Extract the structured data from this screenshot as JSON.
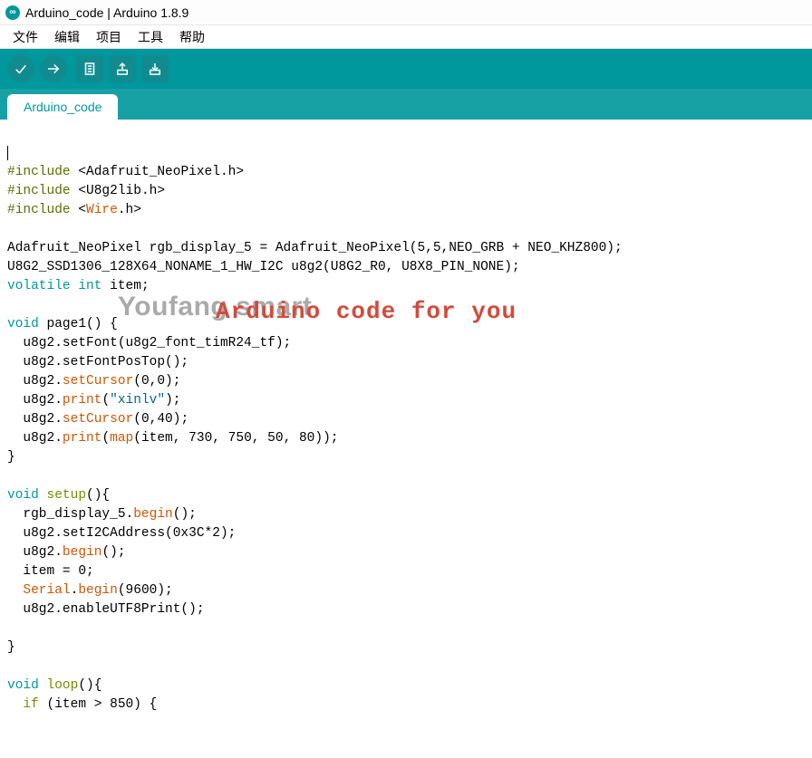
{
  "title": "Arduino_code | Arduino 1.8.9",
  "menu": [
    "文件",
    "编辑",
    "项目",
    "工具",
    "帮助"
  ],
  "tab_label": "Arduino_code",
  "watermark_grey": "Youfang smart",
  "watermark_red": "Arduino code for you",
  "code": {
    "inc1_pre": "#include",
    "inc1_rest": " <Adafruit_NeoPixel.h>",
    "inc2_pre": "#include",
    "inc2_rest": " <U8g2lib.h>",
    "inc3_pre": "#include",
    "inc3_open": " <",
    "inc3_lib": "Wire",
    "inc3_close": ".h>",
    "ln_decl1_a": "Adafruit_NeoPixel rgb_display_5 = Adafruit_NeoPixel(5,5,NEO_GRB + NEO_KHZ800);",
    "ln_decl2_a": "U8G2_SSD1306_128X64_NONAME_1_HW_I2C u8g2(U8G2_R0, U8X8_PIN_NONE);",
    "kw_volatile": "volatile",
    "kw_int": "int",
    "item_decl_rest": " item;",
    "kw_void1": "void",
    "page1_sig": " page1() {",
    "p1_l1a": "  u8g2.setFont(u8g2_font_timR24_tf);",
    "p1_l2a": "  u8g2.setFontPosTop();",
    "p1_l3_pre": "  u8g2.",
    "p1_l3_m": "setCursor",
    "p1_l3_rest": "(0,0);",
    "p1_l4_pre": "  u8g2.",
    "p1_l4_m": "print",
    "p1_l4_open": "(",
    "p1_l4_str": "\"xinlv\"",
    "p1_l4_close": ");",
    "p1_l5_pre": "  u8g2.",
    "p1_l5_m": "setCursor",
    "p1_l5_rest": "(0,40);",
    "p1_l6_pre": "  u8g2.",
    "p1_l6_m": "print",
    "p1_l6_open": "(",
    "p1_l6_map": "map",
    "p1_l6_rest": "(item, 730, 750, 50, 80));",
    "brace_close": "}",
    "kw_void2": "void",
    "kw_setup": "setup",
    "setup_sig_rest": "(){",
    "s_l1_pre": "  rgb_display_5.",
    "s_l1_m": "begin",
    "s_l1_rest": "();",
    "s_l2": "  u8g2.setI2CAddress(0x3C*2);",
    "s_l3_pre": "  u8g2.",
    "s_l3_m": "begin",
    "s_l3_rest": "();",
    "s_l4": "  item = 0;",
    "s_l5_pre": "  ",
    "s_l5_serial": "Serial",
    "s_l5_dot": ".",
    "s_l5_m": "begin",
    "s_l5_rest": "(9600);",
    "s_l6": "  u8g2.enableUTF8Print();",
    "kw_void3": "void",
    "kw_loop": "loop",
    "loop_sig_rest": "(){",
    "lp_l1_pre": "  ",
    "lp_l1_if": "if",
    "lp_l1_rest": " (item > 850) {"
  }
}
